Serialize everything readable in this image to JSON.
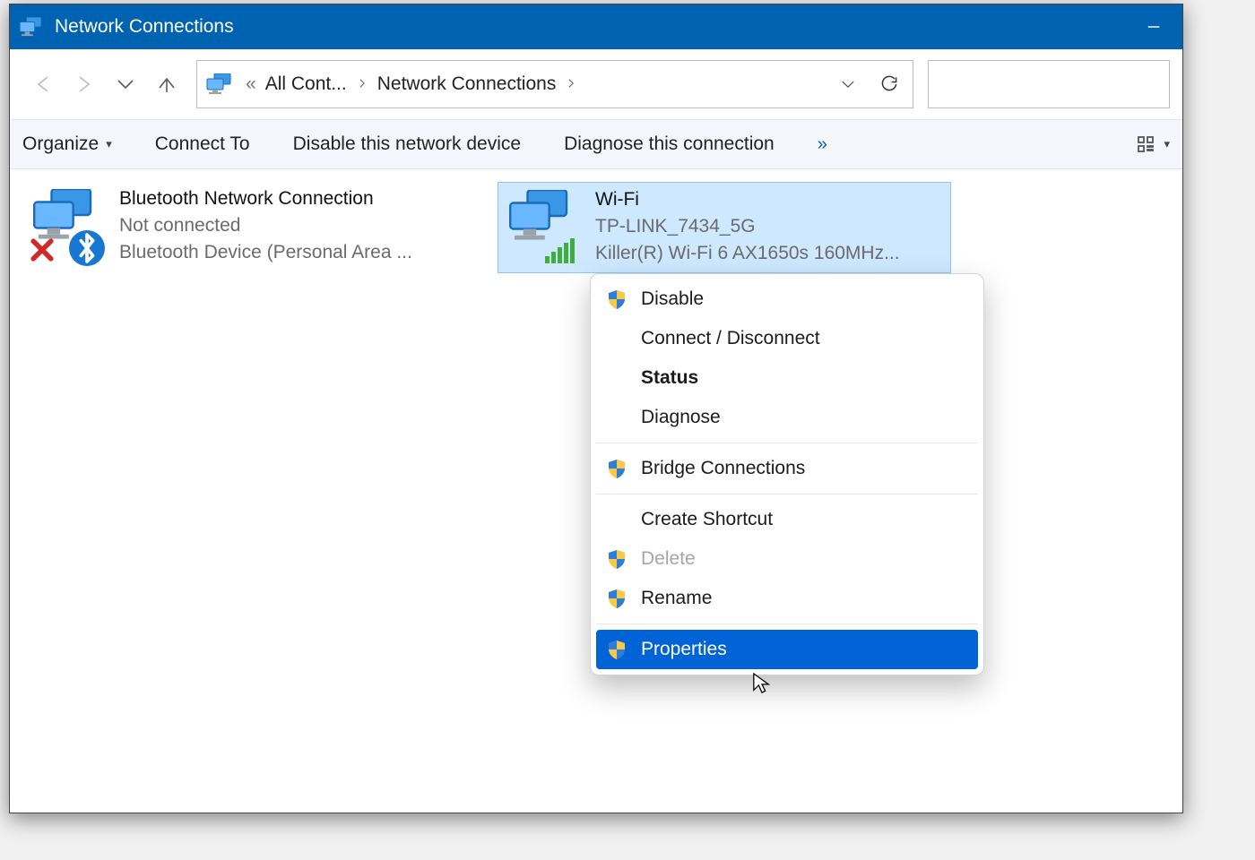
{
  "window": {
    "title": "Network Connections"
  },
  "breadcrumb": {
    "truncated_root": "All Cont...",
    "current": "Network Connections",
    "laquo": "«"
  },
  "toolbar": {
    "organize": "Organize",
    "connect_to": "Connect To",
    "disable_device": "Disable this network device",
    "diagnose": "Diagnose this connection",
    "overflow": "»"
  },
  "connections": [
    {
      "name": "Bluetooth Network Connection",
      "status": "Not connected",
      "device": "Bluetooth Device (Personal Area ..."
    },
    {
      "name": "Wi-Fi",
      "status": "TP-LINK_7434_5G",
      "device": "Killer(R) Wi-Fi 6 AX1650s 160MHz..."
    }
  ],
  "context_menu": {
    "disable": "Disable",
    "connect_disconnect": "Connect / Disconnect",
    "status": "Status",
    "diagnose": "Diagnose",
    "bridge": "Bridge Connections",
    "create_shortcut": "Create Shortcut",
    "delete": "Delete",
    "rename": "Rename",
    "properties": "Properties"
  }
}
